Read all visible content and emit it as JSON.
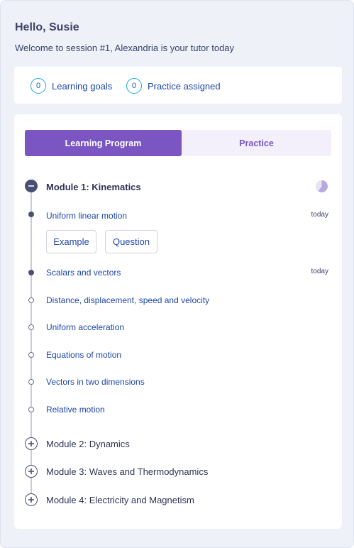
{
  "header": {
    "greeting": "Hello, Susie",
    "welcome": "Welcome to session #1, Alexandria is your tutor today"
  },
  "stats": [
    {
      "count": "0",
      "label": "Learning goals"
    },
    {
      "count": "0",
      "label": "Practice assigned"
    }
  ],
  "tabs": [
    {
      "label": "Learning Program",
      "active": true
    },
    {
      "label": "Practice",
      "active": false
    }
  ],
  "modules": [
    {
      "title": "Module 1: Kinematics",
      "expanded": true,
      "progress_fraction": 0.6,
      "lessons": [
        {
          "title": "Uniform linear motion",
          "date": "today",
          "status": "done"
        },
        {
          "title": "Scalars and vectors",
          "date": "today",
          "status": "done"
        },
        {
          "title": "Distance, displacement, speed and velocity",
          "date": "",
          "status": "pending"
        },
        {
          "title": "Uniform acceleration",
          "date": "",
          "status": "pending"
        },
        {
          "title": "Equations of motion",
          "date": "",
          "status": "pending"
        },
        {
          "title": "Vectors in two dimensions",
          "date": "",
          "status": "pending"
        },
        {
          "title": "Relative motion",
          "date": "",
          "status": "pending"
        }
      ],
      "actions": [
        "Example",
        "Question"
      ]
    },
    {
      "title": "Module 2: Dynamics",
      "expanded": false
    },
    {
      "title": "Module 3: Waves and Thermodynamics",
      "expanded": false
    },
    {
      "title": "Module 4: Electricity and Magnetism",
      "expanded": false
    }
  ],
  "icons": {
    "expanded": "minus-circle-icon",
    "collapsed": "plus-circle-icon",
    "progress": "progress-pie-icon"
  },
  "colors": {
    "accent": "#7b55c2",
    "link": "#1f48a8",
    "badge_border": "#1aa9e0",
    "dark": "#4b4f73"
  }
}
